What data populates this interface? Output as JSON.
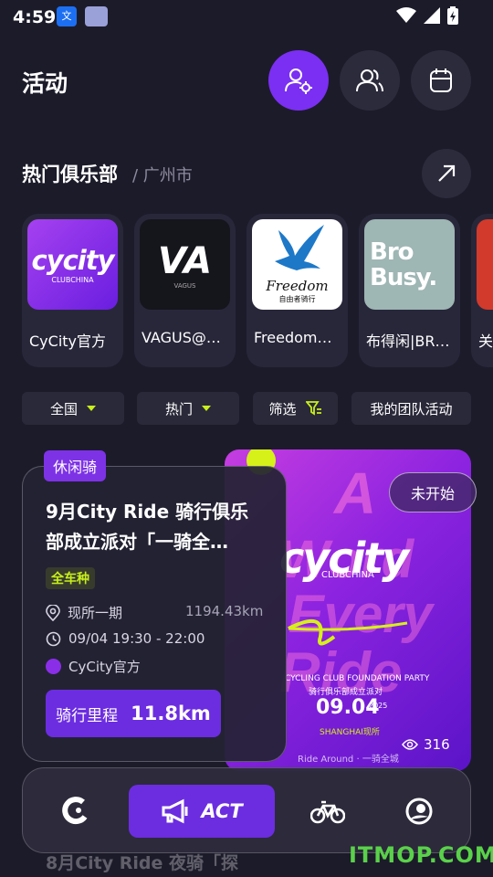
{
  "status_bar": {
    "time": "4:59"
  },
  "header": {
    "title": "活动"
  },
  "hot_clubs": {
    "title": "热门俱乐部",
    "city": "/ 广州市",
    "clubs": [
      {
        "name": "CyCity官方",
        "logo_text": "cycity",
        "logo_sub": "CLUBCHINA"
      },
      {
        "name": "VAGUS@…",
        "logo_text": "VA",
        "logo_sub": "VAGUS"
      },
      {
        "name": "Freedom…",
        "logo_text": "Freedom",
        "logo_sub": "自由者骑行"
      },
      {
        "name": "布得闲|BR…",
        "logo_text": "Bro Busy.",
        "logo_sub": ""
      },
      {
        "name": "关",
        "logo_text": "",
        "logo_sub": ""
      }
    ]
  },
  "filters": {
    "region": "全国",
    "sort": "热门",
    "filter": "筛选",
    "my_team": "我的团队活动"
  },
  "activity": {
    "tag": "休闲骑",
    "title": "9月City Ride 骑行俱乐部成立派对「一骑全…",
    "bike_type": "全车种",
    "location": "现所一期",
    "distance": "1194.43km",
    "time": "09/04 19:30 - 22:00",
    "organizer": "CyCity官方",
    "ride_label": "骑行里程",
    "ride_value": "11.8km",
    "status": "未开始",
    "views": "316",
    "poster": {
      "bg_text": "A Word Every Ride",
      "brand": "cycity",
      "brand_sub": "CLUBCHINA",
      "event": "CYCLING CLUB FOUNDATION PARTY",
      "event_cn": "骑行俱乐部成立派对",
      "date": "09.04",
      "year": "2025",
      "place": "SHANGHAI现所",
      "footer": "Ride Around · 一骑全城"
    }
  },
  "tabbar": {
    "act_label": "ACT"
  },
  "next_card_peek": "8月City Ride 夜骑「探",
  "watermark": "ITMOP.COM",
  "colors": {
    "accent": "#7b2ff2",
    "lime": "#c8f01a",
    "bg": "#1c1b2a"
  }
}
